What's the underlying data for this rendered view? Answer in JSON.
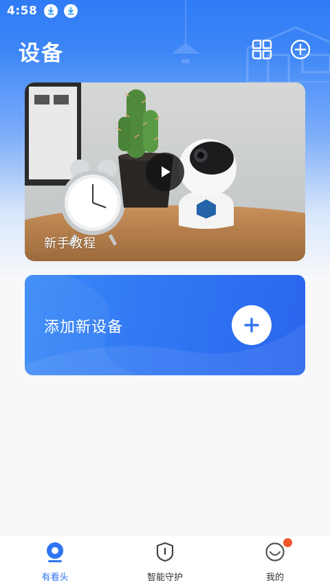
{
  "status_bar": {
    "time": "4:58",
    "icons": [
      "download-icon",
      "download-icon"
    ]
  },
  "header": {
    "title": "设备",
    "actions": [
      "grid-view-icon",
      "add-circle-icon"
    ]
  },
  "tutorial_card": {
    "label": "新手教程",
    "media_icon": "play-icon"
  },
  "add_device_card": {
    "label": "添加新设备",
    "icon": "plus-icon"
  },
  "bottom_nav": {
    "items": [
      {
        "label": "有看头",
        "icon": "camera-eye-icon",
        "active": true
      },
      {
        "label": "智能守护",
        "icon": "shield-icon",
        "active": false
      },
      {
        "label": "我的",
        "icon": "profile-icon",
        "active": false,
        "has_notification": true
      }
    ]
  },
  "colors": {
    "primary": "#2f74f2",
    "header_gradient_top": "#2f7bf6",
    "background": "#f7f8fa",
    "notification": "#f2552c"
  }
}
